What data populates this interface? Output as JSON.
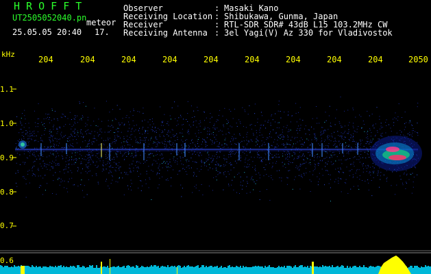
{
  "header": {
    "logo": "H R O F F T",
    "filename": "UT2505052040.pn",
    "type": "meteor",
    "datetime": "25.05.05 20:40",
    "count": "17."
  },
  "info": [
    {
      "label": "Observer",
      "value": "Masaki Kano"
    },
    {
      "label": "Receiving Location",
      "value": "Shibukawa, Gunma, Japan"
    },
    {
      "label": "Receiver",
      "value": "RTL-SDR SDR# 43dB L15 103.2MHz CW"
    },
    {
      "label": "Receiving Antenna",
      "value": "3el Yagi(V) Az 330 for Vladivostok"
    }
  ],
  "separator": ":",
  "axis": {
    "unit": "kHz",
    "y_ticks": [
      "1.1",
      "1.0",
      "0.9",
      "0.8",
      "0.7",
      "0.6"
    ],
    "x_ticks": [
      "204",
      "204",
      "204",
      "204",
      "204",
      "204",
      "204",
      "204",
      "204",
      "2050"
    ]
  },
  "colors": {
    "logo": "#2bff2b",
    "axis_text": "#ffff00",
    "signal_line": "#3b5cff",
    "spectrum": "#00d7ff",
    "peak": "#ffff00"
  }
}
